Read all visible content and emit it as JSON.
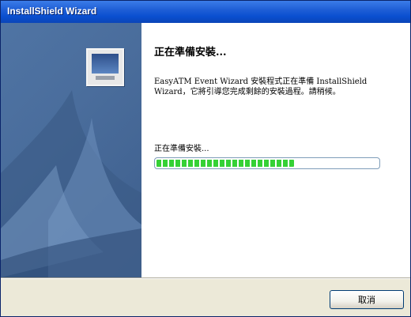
{
  "window": {
    "title": "InstallShield Wizard"
  },
  "banner": {
    "icon": "monitor-icon"
  },
  "content": {
    "heading": "正在準備安裝...",
    "description": "EasyATM Event Wizard 安裝程式正在準備 InstallShield Wizard，它將引導您完成剩餘的安裝過程。請稍候。",
    "status": "正在準備安裝...",
    "progress": 0.62
  },
  "footer": {
    "cancel_label": "取消"
  },
  "colors": {
    "progress_green": "#35d135",
    "banner_blue": "#4a6d9c",
    "titlebar_blue": "#0a4fd0"
  }
}
